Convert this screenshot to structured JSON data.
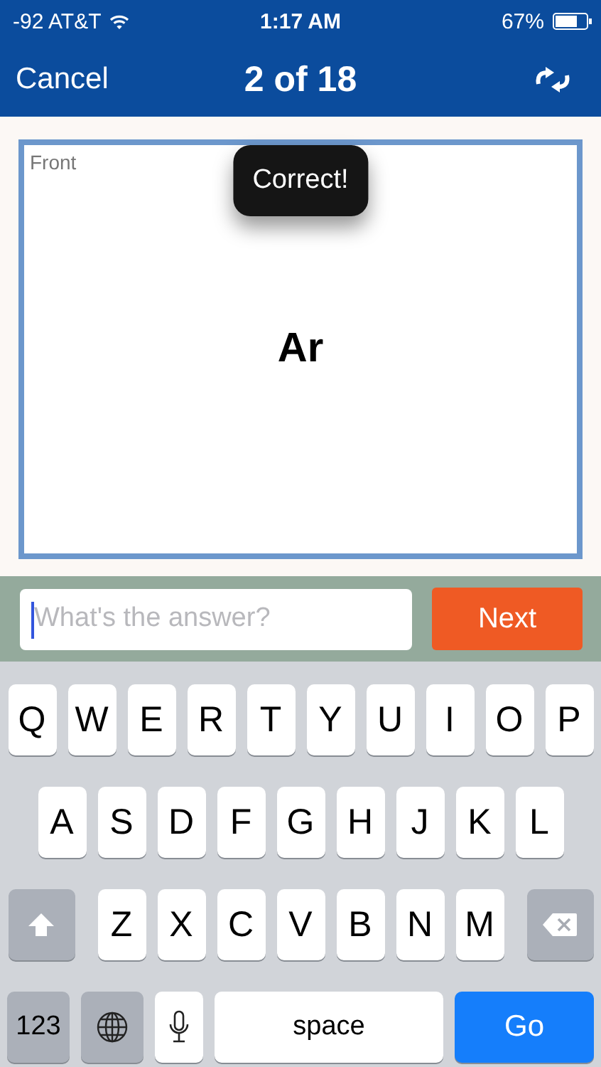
{
  "status_bar": {
    "carrier": "-92 AT&T",
    "time": "1:17 AM",
    "battery": "67%"
  },
  "nav_bar": {
    "cancel": "Cancel",
    "title": "2 of 18"
  },
  "card": {
    "side_label": "Front",
    "term": "Ar"
  },
  "toast": {
    "text": "Correct!"
  },
  "answer_field": {
    "placeholder": "What's the answer?"
  },
  "next_button": "Next",
  "keyboard": {
    "rows": [
      {
        "keys": [
          {
            "kind": "letter",
            "label": "Q"
          },
          {
            "kind": "letter",
            "label": "W"
          },
          {
            "kind": "letter",
            "label": "E"
          },
          {
            "kind": "letter",
            "label": "R"
          },
          {
            "kind": "letter",
            "label": "T"
          },
          {
            "kind": "letter",
            "label": "Y"
          },
          {
            "kind": "letter",
            "label": "U"
          },
          {
            "kind": "letter",
            "label": "I"
          },
          {
            "kind": "letter",
            "label": "O"
          },
          {
            "kind": "letter",
            "label": "P"
          }
        ]
      },
      {
        "keys": [
          {
            "kind": "letter",
            "label": "A"
          },
          {
            "kind": "letter",
            "label": "S"
          },
          {
            "kind": "letter",
            "label": "D"
          },
          {
            "kind": "letter",
            "label": "F"
          },
          {
            "kind": "letter",
            "label": "G"
          },
          {
            "kind": "letter",
            "label": "H"
          },
          {
            "kind": "letter",
            "label": "J"
          },
          {
            "kind": "letter",
            "label": "K"
          },
          {
            "kind": "letter",
            "label": "L"
          }
        ]
      },
      {
        "keys": [
          {
            "kind": "shift"
          },
          {
            "kind": "letter",
            "label": "Z"
          },
          {
            "kind": "letter",
            "label": "X"
          },
          {
            "kind": "letter",
            "label": "C"
          },
          {
            "kind": "letter",
            "label": "V"
          },
          {
            "kind": "letter",
            "label": "B"
          },
          {
            "kind": "letter",
            "label": "N"
          },
          {
            "kind": "letter",
            "label": "M"
          },
          {
            "kind": "delete"
          }
        ]
      },
      {
        "keys": [
          {
            "kind": "numbers",
            "label": "123"
          },
          {
            "kind": "globe"
          },
          {
            "kind": "mic"
          },
          {
            "kind": "space",
            "label": "space"
          },
          {
            "kind": "go",
            "label": "Go"
          }
        ]
      }
    ]
  }
}
